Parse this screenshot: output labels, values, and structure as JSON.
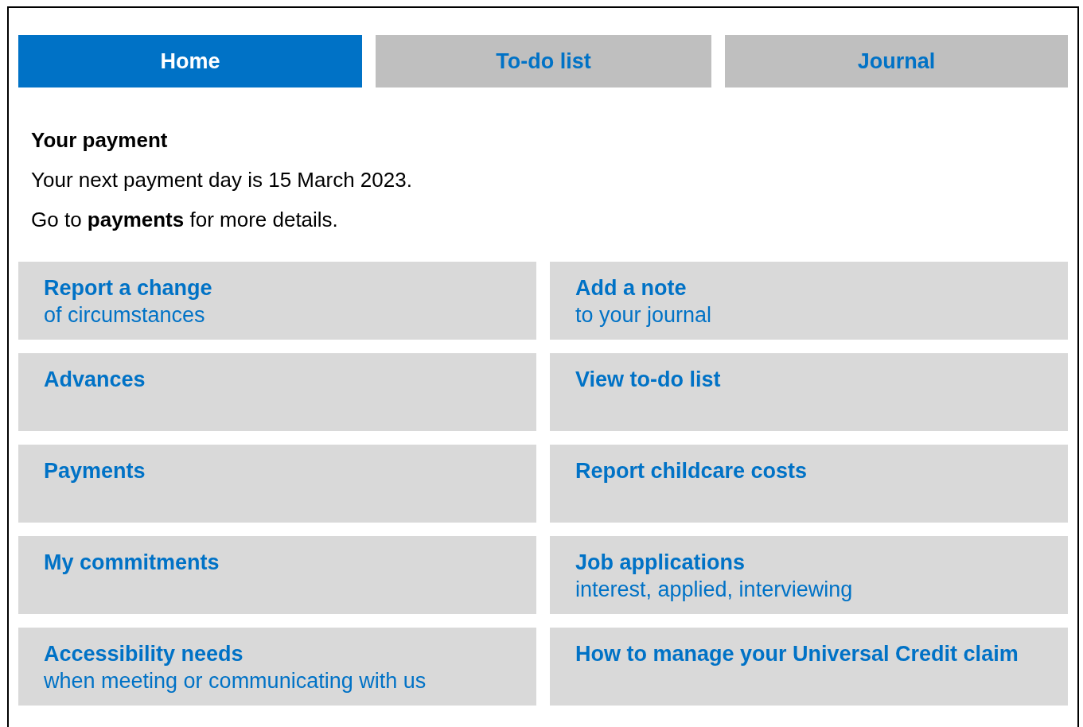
{
  "tabs": [
    {
      "label": "Home",
      "selected": true
    },
    {
      "label": "To-do list",
      "selected": false
    },
    {
      "label": "Journal",
      "selected": false
    }
  ],
  "payment": {
    "heading": "Your payment",
    "lines": [
      "Your next payment day is 15 March 2023.",
      "Go to **payments** for more details."
    ]
  },
  "tiles": [
    {
      "title": "Report a change",
      "subtitle": "of circumstances"
    },
    {
      "title": "Add a note",
      "subtitle": "to your journal"
    },
    {
      "title": "Advances"
    },
    {
      "title": "View to-do list"
    },
    {
      "title": "Payments"
    },
    {
      "title": "Report childcare costs"
    },
    {
      "title": "My commitments"
    },
    {
      "title": "Job applications",
      "subtitle": "interest, applied, interviewing"
    },
    {
      "title": "Accessibility needs",
      "subtitle": "when meeting or communicating with us"
    },
    {
      "title": "How to manage your Universal Credit claim"
    }
  ]
}
